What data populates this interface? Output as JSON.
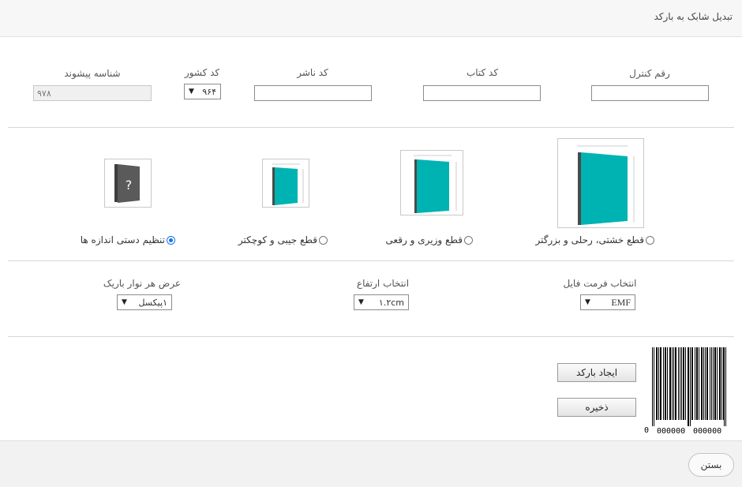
{
  "dialog": {
    "title": "تبدیل شابک به بارکد"
  },
  "fields": {
    "control_digit": {
      "label": "رقم کنترل",
      "value": ""
    },
    "book_code": {
      "label": "کد کتاب",
      "value": ""
    },
    "publisher_code": {
      "label": "کد ناشر",
      "value": ""
    },
    "country_code": {
      "label": "کد کشور",
      "selected": "۹۶۴"
    },
    "prefix": {
      "label": "شناسه پیشوند",
      "value": "۹۷۸"
    }
  },
  "sizes": [
    {
      "label": "قطع خشتی، رحلی و بزرگتر",
      "selected": false
    },
    {
      "label": "قطع وزیری و رقعی",
      "selected": false
    },
    {
      "label": "قطع جیبی و کوچکتر",
      "selected": false
    },
    {
      "label": "تنظیم دستی اندازه ها",
      "selected": true
    }
  ],
  "options": {
    "file_format": {
      "label": "انتخاب فرمت فایل",
      "selected": "EMF"
    },
    "height": {
      "label": "انتخاب ارتفاع",
      "selected": "۱.۲cm"
    },
    "bar_width": {
      "label": "عرض هر نوار باریک",
      "selected": "۱پیکسل"
    }
  },
  "actions": {
    "create": "ایجاد بارکد",
    "save": "ذخیره"
  },
  "barcode": {
    "lead_digit": "0",
    "left_group": "000000",
    "right_group": "000000"
  },
  "footer": {
    "close": "بستن"
  },
  "colors": {
    "book": "#00b3b3",
    "book_spine": "#4a4a4a",
    "unknown_book": "#5a5a5a"
  },
  "icons": {
    "dropdown": "chevron-down-icon",
    "unknown": "question-mark"
  }
}
